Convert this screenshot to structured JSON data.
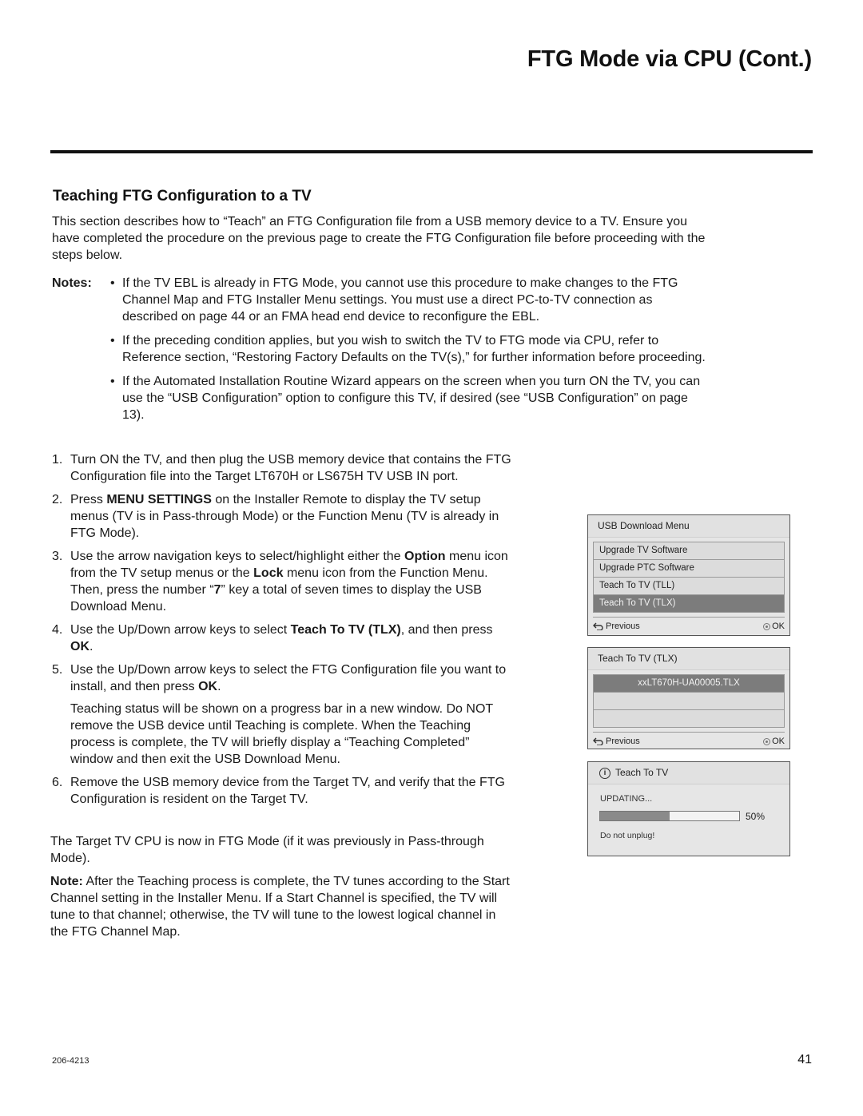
{
  "header": {
    "title": "FTG Mode via CPU (Cont.)"
  },
  "section": {
    "title": "Teaching FTG Configuration to a TV",
    "intro": "This section describes how to “Teach” an FTG Configuration file from a USB memory device to a TV. Ensure you have completed the procedure on the previous page to create the FTG Configuration file before proceeding with the steps below."
  },
  "notes": {
    "label": "Notes:",
    "bullet": "•",
    "items": [
      "If the TV EBL is already in FTG Mode, you cannot use this procedure to make changes to the FTG Channel Map and FTG Installer Menu settings. You must use a direct PC-to-TV connection as described on page 44 or an FMA head end device to reconfigure the EBL.",
      "If the preceding condition applies, but you wish to switch the TV to FTG mode via CPU, refer to Reference section, “Restoring Factory Defaults on the TV(s),” for further information before proceeding.",
      "If the Automated Installation Routine Wizard appears on the screen when you turn ON the TV, you can use the “USB Configuration” option to configure this TV, if desired (see “USB Configuration” on page 13)."
    ]
  },
  "steps": [
    {
      "num": "1.",
      "parts": [
        "Turn ON the TV, and then plug the USB memory device that contains the FTG Configuration file into the Target LT670H or LS675H TV USB IN port."
      ]
    },
    {
      "num": "2.",
      "parts": [
        "Press ",
        "MENU SETTINGS",
        " on the Installer Remote to display the TV setup menus (TV is in Pass-through Mode) or the Function Menu (TV is already in FTG Mode)."
      ]
    },
    {
      "num": "3.",
      "parts": [
        "Use the arrow navigation keys to select/highlight either the ",
        "Option",
        " menu icon from the TV setup menus or the ",
        "Lock",
        " menu icon from the Function Menu. Then, press the number “",
        "7",
        "” key a total of seven times to display the USB Download Menu."
      ]
    },
    {
      "num": "4.",
      "parts": [
        "Use the Up/Down arrow keys to select ",
        "Teach To TV (TLX)",
        ", and then press ",
        "OK",
        "."
      ]
    },
    {
      "num": "5.",
      "parts": [
        "Use the Up/Down arrow keys to select the FTG Configuration file you want to install, and then press ",
        "OK",
        "."
      ],
      "extra": "Teaching status will be shown on a progress bar in a new window. Do NOT remove the USB device until Teaching is complete. When the Teaching process is complete, the TV will briefly display a “Teaching Completed” window and then exit the USB Download Menu."
    },
    {
      "num": "6.",
      "parts": [
        "Remove the USB memory device from the Target TV, and verify that the FTG Configuration is resident on the Target TV."
      ]
    }
  ],
  "closing": {
    "text": "The Target TV CPU is now in FTG Mode (if it was previously in Pass-through Mode).",
    "note_label": "Note:",
    "note_text": " After the Teaching process is complete, the TV tunes according to the Start Channel setting in the Installer Menu. If a Start Channel is specified, the TV will tune to that channel; otherwise, the TV will tune to the lowest logical channel in the FTG Channel Map."
  },
  "screens": {
    "usb_menu": {
      "title": "USB Download Menu",
      "items": [
        "Upgrade TV Software",
        "Upgrade PTC Software",
        "Teach To TV (TLL)",
        "Teach To TV (TLX)"
      ],
      "selected_index": 3,
      "previous_label": "Previous",
      "ok_label": "OK"
    },
    "teach_tlx": {
      "title": "Teach To TV (TLX)",
      "files": [
        "xxLT670H-UA00005.TLX",
        "",
        ""
      ],
      "selected_index": 0,
      "previous_label": "Previous",
      "ok_label": "OK"
    },
    "progress": {
      "title": "Teach To TV",
      "status": "UPDATING...",
      "percent": 50,
      "percent_label": "50%",
      "warning": "Do not unplug!"
    }
  },
  "footer": {
    "doc_number": "206-4213",
    "page_number": "41"
  }
}
